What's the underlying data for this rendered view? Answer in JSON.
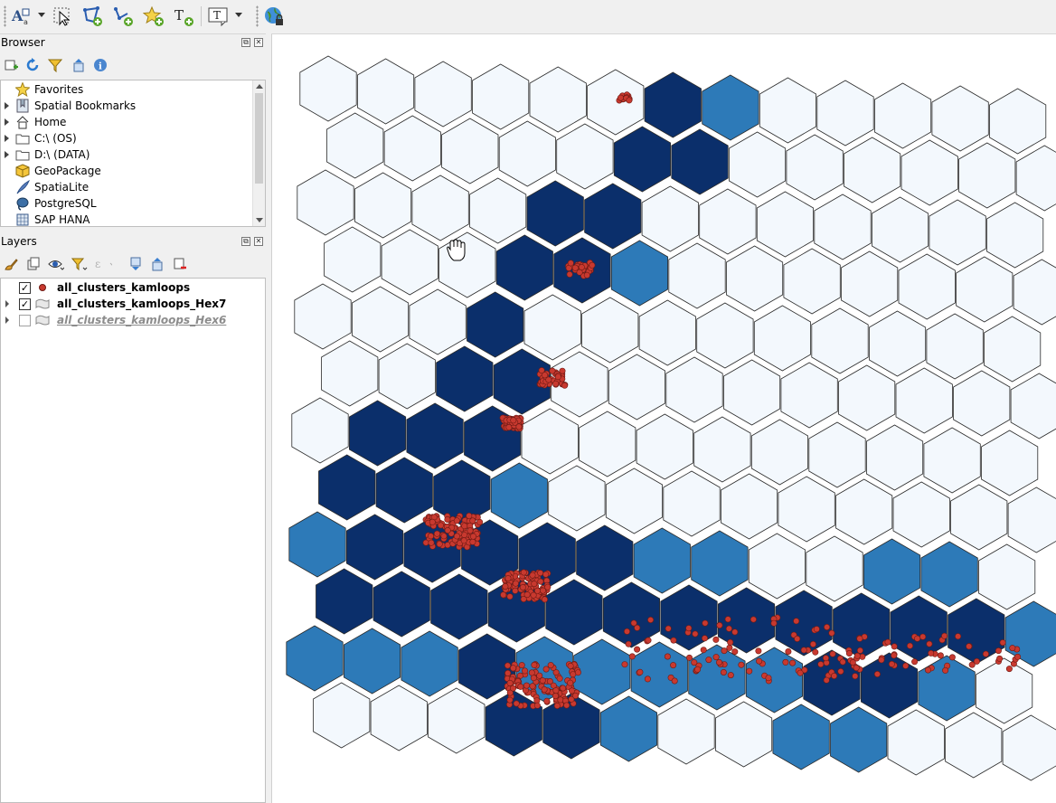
{
  "toolbar": {
    "buttons": [
      {
        "name": "label-tool",
        "icon": "label-icon",
        "dropdown": true
      },
      {
        "name": "select-features",
        "icon": "select-cursor-icon"
      },
      {
        "name": "add-polygon",
        "icon": "polygon-add-icon"
      },
      {
        "name": "add-line",
        "icon": "line-add-icon"
      },
      {
        "name": "add-point",
        "icon": "star-add-icon"
      },
      {
        "name": "add-text",
        "icon": "text-add-icon"
      },
      {
        "name": "text-annotation",
        "icon": "text-box-icon",
        "dropdown": true
      },
      {
        "name": "georeference",
        "icon": "globe-lock-icon"
      }
    ]
  },
  "browser": {
    "title": "Browser",
    "items": [
      {
        "label": "Favorites",
        "icon": "star-icon",
        "expandable": false
      },
      {
        "label": "Spatial Bookmarks",
        "icon": "bookmark-icon",
        "expandable": true
      },
      {
        "label": "Home",
        "icon": "home-icon",
        "expandable": true
      },
      {
        "label": "C:\\ (OS)",
        "icon": "folder-icon",
        "expandable": true
      },
      {
        "label": "D:\\ (DATA)",
        "icon": "folder-icon",
        "expandable": true
      },
      {
        "label": "GeoPackage",
        "icon": "geopackage-icon",
        "expandable": false
      },
      {
        "label": "SpatiaLite",
        "icon": "feather-icon",
        "expandable": false
      },
      {
        "label": "PostgreSQL",
        "icon": "elephant-icon",
        "expandable": false
      },
      {
        "label": "SAP HANA",
        "icon": "database-icon",
        "expandable": false
      }
    ]
  },
  "layers": {
    "title": "Layers",
    "items": [
      {
        "label": "all_clusters_kamloops",
        "checked": true,
        "type": "point",
        "color": "#c8392f"
      },
      {
        "label": "all_clusters_kamloops_Hex7",
        "checked": true,
        "type": "polygon"
      },
      {
        "label": "all_clusters_kamloops_Hex6",
        "checked": false,
        "type": "polygon"
      }
    ]
  },
  "map": {
    "colors": {
      "class_empty": "#f3f8fd",
      "class_mid": "#2d7ab8",
      "class_high": "#0b2f6b",
      "outline": "#2b2b2b",
      "points_fill": "#c8392f",
      "points_stroke": "#6e1a14"
    }
  }
}
